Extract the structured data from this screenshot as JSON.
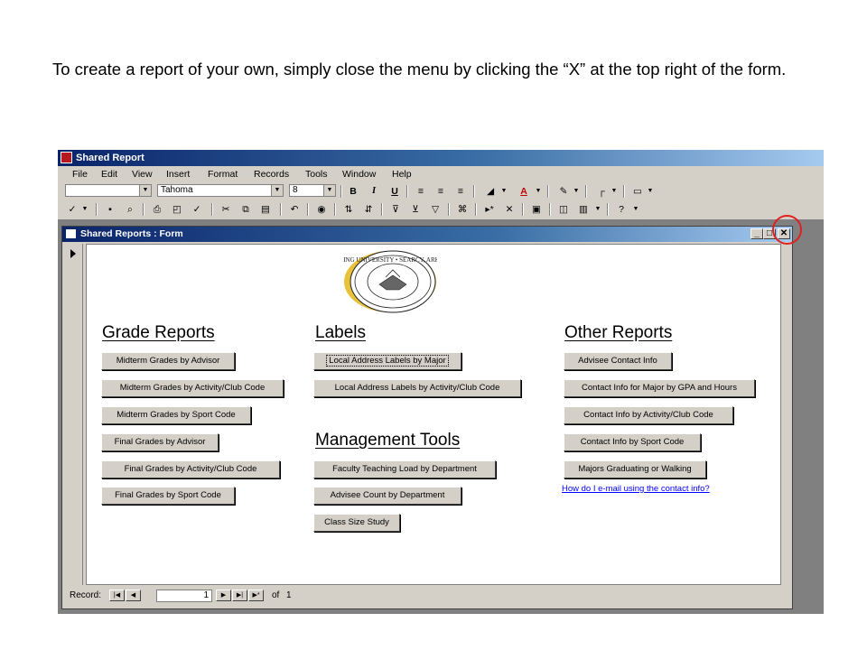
{
  "instruction": "To create a report of your own, simply close the menu by clicking the “X” at the top right of the form.",
  "app": {
    "title": "Shared Report",
    "menu": [
      "File",
      "Edit",
      "View",
      "Insert",
      "Format",
      "Records",
      "Tools",
      "Window",
      "Help"
    ],
    "font_name": "Tahoma",
    "font_size": "8",
    "bold": "B",
    "italic": "I",
    "underline": "U"
  },
  "form": {
    "title": "Shared Reports : Form",
    "seal_text": "HARDING UNIVERSITY • SEARCY, ARKANSAS",
    "grade": {
      "heading": "Grade Reports",
      "buttons": [
        "Midterm Grades by Advisor",
        "Midterm Grades by Activity/Club Code",
        "Midterm Grades by Sport Code",
        "Final Grades by Advisor",
        "Final Grades by Activity/Club Code",
        "Final Grades by Sport Code"
      ]
    },
    "labels": {
      "heading": "Labels",
      "buttons": [
        "Local Address Labels by Major",
        "Local Address Labels by Activity/Club Code"
      ]
    },
    "management": {
      "heading": "Management Tools",
      "buttons": [
        "Faculty Teaching Load by Department",
        "Advisee Count by Department",
        "Class Size Study"
      ]
    },
    "other": {
      "heading": "Other Reports",
      "buttons": [
        "Advisee Contact Info",
        "Contact Info for Major by GPA and Hours",
        "Contact Info by Activity/Club Code",
        "Contact Info by Sport Code",
        "Majors Graduating or Walking"
      ],
      "link": "How do I e-mail using the contact info?"
    }
  },
  "nav": {
    "label": "Record:",
    "current": "1",
    "of_label": "of",
    "total": "1"
  }
}
